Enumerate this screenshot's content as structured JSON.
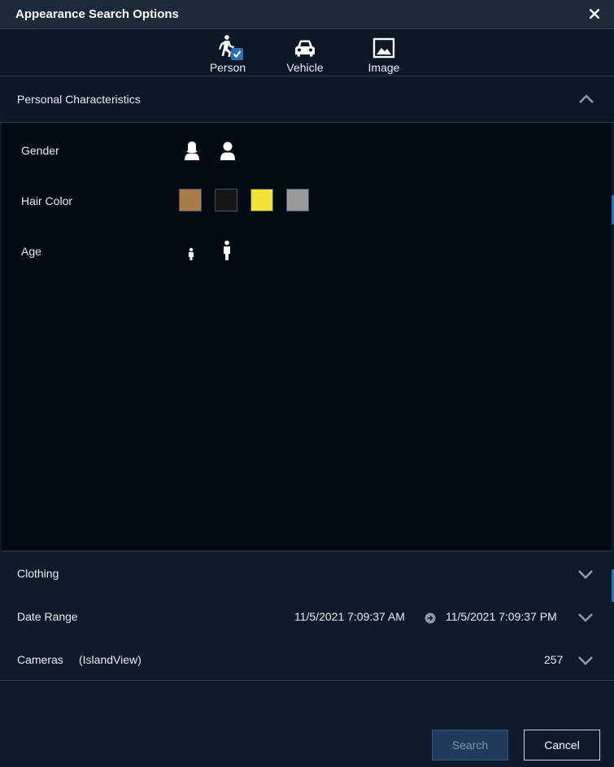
{
  "window": {
    "title": "Appearance Search Options"
  },
  "tabs": [
    {
      "label": "Person",
      "icon": "person-running-icon",
      "selected": true
    },
    {
      "label": "Vehicle",
      "icon": "car-icon",
      "selected": false
    },
    {
      "label": "Image",
      "icon": "image-icon",
      "selected": false
    }
  ],
  "personal": {
    "header": "Personal Characteristics",
    "expanded": true,
    "rows": {
      "gender": {
        "label": "Gender",
        "options": [
          "female-icon",
          "male-icon"
        ]
      },
      "hair_color": {
        "label": "Hair Color",
        "colors": [
          "#a87c4a",
          "#161616",
          "#f2e23a",
          "#9a9a9a"
        ]
      },
      "age": {
        "label": "Age",
        "options": [
          "child-icon",
          "adult-icon"
        ]
      }
    }
  },
  "clothing": {
    "label": "Clothing"
  },
  "date_range": {
    "label": "Date Range",
    "start": "11/5/2021 7:09:37 AM",
    "end": "11/5/2021 7:09:37 PM"
  },
  "cameras": {
    "label": "Cameras",
    "site": "(IslandView)",
    "count": "257"
  },
  "buttons": {
    "search": "Search",
    "cancel": "Cancel"
  },
  "colors": {
    "accent": "#2e6fb5",
    "background": "#0e1a2a",
    "panel": "#040a14"
  }
}
